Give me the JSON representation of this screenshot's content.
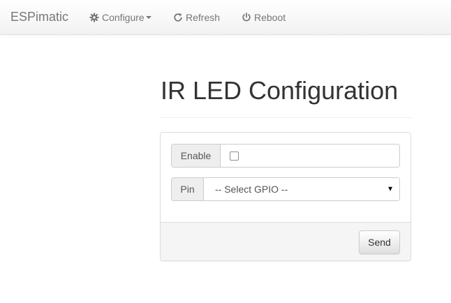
{
  "navbar": {
    "brand": "ESPimatic",
    "items": [
      {
        "label": "Configure",
        "icon": "gear-icon",
        "has_caret": true
      },
      {
        "label": "Refresh",
        "icon": "refresh-icon"
      },
      {
        "label": "Reboot",
        "icon": "power-icon"
      }
    ]
  },
  "main": {
    "title": "IR LED Configuration",
    "form": {
      "enable_label": "Enable",
      "enable_checked": false,
      "pin_label": "Pin",
      "pin_selected": "-- Select GPIO --",
      "send_label": "Send"
    }
  },
  "colors": {
    "navbar_text": "#777777",
    "addon_bg": "#eeeeee",
    "panel_footer_bg": "#f5f5f5",
    "border": "#cccccc"
  }
}
